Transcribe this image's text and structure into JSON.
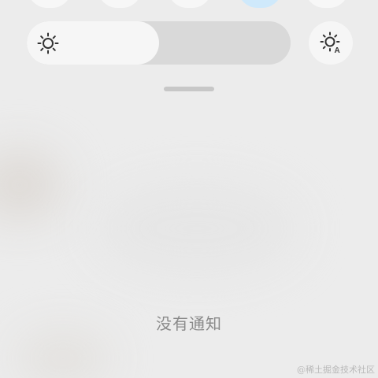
{
  "quick_settings": {
    "toggles": [
      {
        "icon": "toggle-icon",
        "active": false
      },
      {
        "icon": "toggle-icon",
        "active": false
      },
      {
        "icon": "toggle-icon",
        "active": false
      },
      {
        "icon": "toggle-icon",
        "active": true
      },
      {
        "icon": "toggle-icon",
        "active": false
      }
    ],
    "brightness": {
      "icon": "brightness-icon",
      "level": 0.5
    },
    "auto_brightness": {
      "icon": "auto-brightness-icon",
      "badge": "A"
    }
  },
  "notifications": {
    "empty_text": "没有通知"
  },
  "watermark": {
    "text": "@稀土掘金技术社区"
  },
  "colors": {
    "background": "#ececec",
    "slider_track": "#d9d9d9",
    "slider_fill": "#f6f6f6",
    "active_toggle": "#cfe9fb",
    "icon": "#333333"
  }
}
